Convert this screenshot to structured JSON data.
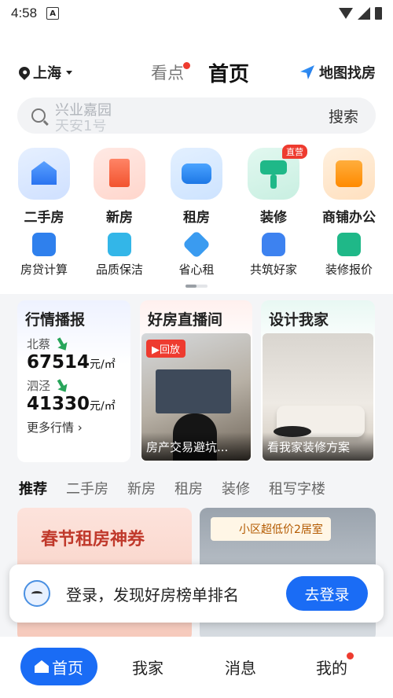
{
  "status_bar": {
    "time": "4:58",
    "notification_icon": "A"
  },
  "header": {
    "city": "上海",
    "tab_kandian": "看点",
    "tab_home": "首页",
    "map_find": "地图找房"
  },
  "search": {
    "placeholder_line1": "兴业嘉园",
    "placeholder_line2": "天安1号",
    "button": "搜索"
  },
  "categories": [
    {
      "label": "二手房",
      "icon": "house-icon"
    },
    {
      "label": "新房",
      "icon": "building-icon"
    },
    {
      "label": "租房",
      "icon": "sofa-icon"
    },
    {
      "label": "装修",
      "icon": "paint-roller-icon",
      "badge": "直营"
    },
    {
      "label": "商铺办公",
      "icon": "shop-icon"
    }
  ],
  "sub_categories": [
    {
      "label": "房贷计算",
      "icon": "calculator-icon"
    },
    {
      "label": "品质保洁",
      "icon": "cleaning-icon"
    },
    {
      "label": "省心租",
      "icon": "check-shield-icon"
    },
    {
      "label": "共筑好家",
      "icon": "heart-home-icon"
    },
    {
      "label": "装修报价",
      "icon": "price-tag-icon"
    }
  ],
  "market": {
    "title": "行情播报",
    "items": [
      {
        "area": "北蔡",
        "price": "67514",
        "unit": "元/㎡"
      },
      {
        "area": "泗泾",
        "price": "41330",
        "unit": "元/㎡"
      }
    ],
    "more": "更多行情"
  },
  "live": {
    "title": "好房直播间",
    "badge": "回放",
    "caption": "房产交易避坑..."
  },
  "design": {
    "title": "设计我家",
    "caption": "看我家装修方案"
  },
  "rec_tabs": [
    "推荐",
    "二手房",
    "新房",
    "租房",
    "装修",
    "租写字楼"
  ],
  "feed": {
    "left_title": "春节租房神券",
    "right_tag": "小区超低价2居室"
  },
  "login_banner": {
    "message": "登录，发现好房榜单排名",
    "button": "去登录"
  },
  "tabbar": {
    "home": "首页",
    "myhome": "我家",
    "messages": "消息",
    "mine": "我的"
  },
  "colors": {
    "brand_blue": "#1a6cf5",
    "badge_red": "#ee3b2f",
    "drop_green": "#27a55a"
  }
}
